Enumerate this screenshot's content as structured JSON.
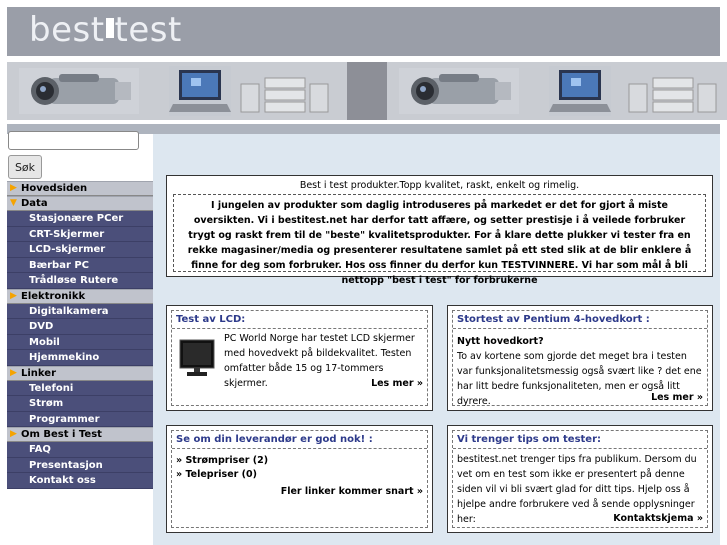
{
  "site": {
    "logo_left": "best",
    "logo_right": "test"
  },
  "banner": {
    "images": [
      "camcorder-image",
      "laptop-image",
      "stereo-image",
      "camcorder-image",
      "laptop-image",
      "stereo-image"
    ]
  },
  "search": {
    "value": "",
    "placeholder": "",
    "button_label": "Søk"
  },
  "sidebar": {
    "accent_color": "#f5a300",
    "sub_color": "#4b4f7a",
    "sections": [
      {
        "label": "Hovedsiden",
        "icon": "chevron-right-icon",
        "items": []
      },
      {
        "label": "Data",
        "icon": "chevron-down-icon",
        "items": [
          "Stasjonære PCer",
          "CRT-Skjermer",
          "LCD-skjermer",
          "Bærbar PC",
          "Trådløse Rutere"
        ]
      },
      {
        "label": "Elektronikk",
        "icon": "chevron-right-icon",
        "items": [
          "Digitalkamera",
          "DVD",
          "Mobil",
          "Hjemmekino"
        ]
      },
      {
        "label": "Linker",
        "icon": "chevron-right-icon",
        "items": [
          "Telefoni",
          "Strøm",
          "Programmer"
        ]
      },
      {
        "label": "Om Best i Test",
        "icon": "chevron-right-icon",
        "items": [
          "FAQ",
          "Presentasjon",
          "Kontakt oss"
        ]
      }
    ]
  },
  "intro": {
    "title": "Best i test produkter.Topp kvalitet, raskt, enkelt og rimelig.",
    "body": "I jungelen av produkter som daglig introduseres på markedet er det for gjort å miste oversikten. Vi i bestitest.net har derfor tatt affære, og setter prestisje i å veilede forbruker trygt og raskt frem til de \"beste\" kvalitetsprodukter. For å klare dette plukker vi tester fra en rekke magasiner/media og presenterer resultatene samlet på ett sted slik at de blir enklere å finne for deg som forbruker. Hos oss finner du derfor kun TESTVINNERE. Vi har som mål å bli nettopp \"best i test\" for forbrukerne"
  },
  "cards": {
    "lcd": {
      "title": "Test av LCD:",
      "body": "PC World Norge har testet LCD skjermer med hovedvekt på bildekvalitet. Testen omfatter både 15 og 17-tommers skjermer.",
      "more": "Les mer »"
    },
    "pentium": {
      "title": "Stortest av Pentium 4-hovedkort :",
      "subtitle": "Nytt hovedkort?",
      "body": "To av kortene som gjorde det meget bra i testen var funksjonalitetsmessig også svært like ? det ene har litt bedre funksjonaliteten, men er også litt dyrere.",
      "more": "Les mer »"
    },
    "supplier": {
      "title": "Se om din leverandør er god nok! :",
      "links": [
        "» Strømpriser (2)",
        "» Telepriser (0)"
      ],
      "more": "Fler linker kommer snart »"
    },
    "tips": {
      "title": "Vi trenger tips om tester:",
      "body": "bestitest.net trenger tips fra publikum. Dersom du vet om en test som ikke er presentert på denne siden vil vi bli svært glad for ditt tips. Hjelp oss å hjelpe andre forbrukere ved å sende opplysninger her:",
      "more": "Kontaktskjema »"
    }
  },
  "colors": {
    "card_title": "#2d3a8a",
    "content_bg": "#dde7f0",
    "header_bg": "#9a9ea8"
  }
}
